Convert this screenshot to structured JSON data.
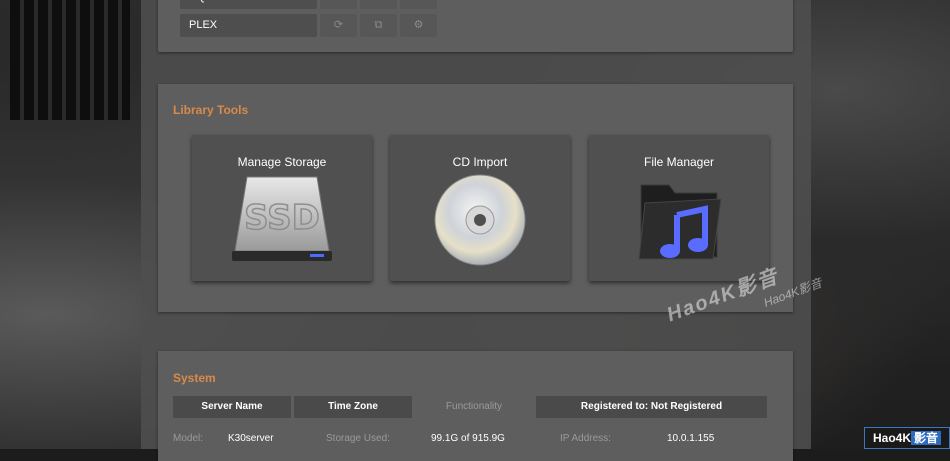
{
  "services": [
    {
      "name": "HQPLAYER",
      "buttons": [
        "⟳",
        "⧉",
        "⚙"
      ]
    },
    {
      "name": "PLEX",
      "buttons": [
        "⟳",
        "⧉",
        "⚙"
      ]
    }
  ],
  "library_tools": {
    "title": "Library Tools",
    "tiles": [
      {
        "label": "Manage Storage",
        "icon": "ssd-drive-icon",
        "icon_text": "SSD"
      },
      {
        "label": "CD Import",
        "icon": "cd-disc-icon"
      },
      {
        "label": "File Manager",
        "icon": "music-folder-icon"
      }
    ]
  },
  "system": {
    "title": "System",
    "headers": [
      "Server Name",
      "Time Zone",
      "Functionality",
      "Registered to: Not Registered"
    ],
    "info": {
      "model_label": "Model:",
      "model_value": "K30server",
      "storage_label": "Storage Used:",
      "storage_value": "99.1G of 915.9G",
      "ip_label": "IP Address:",
      "ip_value": "10.0.1.155"
    }
  },
  "watermark": {
    "line1": "Hao4K影音",
    "line2": "Hao4K影音"
  },
  "badge": {
    "prefix": "Hao4K",
    "suffix": "影音"
  },
  "colors": {
    "accent": "#d88a4a",
    "panel": "#5e5e5e",
    "tile": "#505050"
  }
}
